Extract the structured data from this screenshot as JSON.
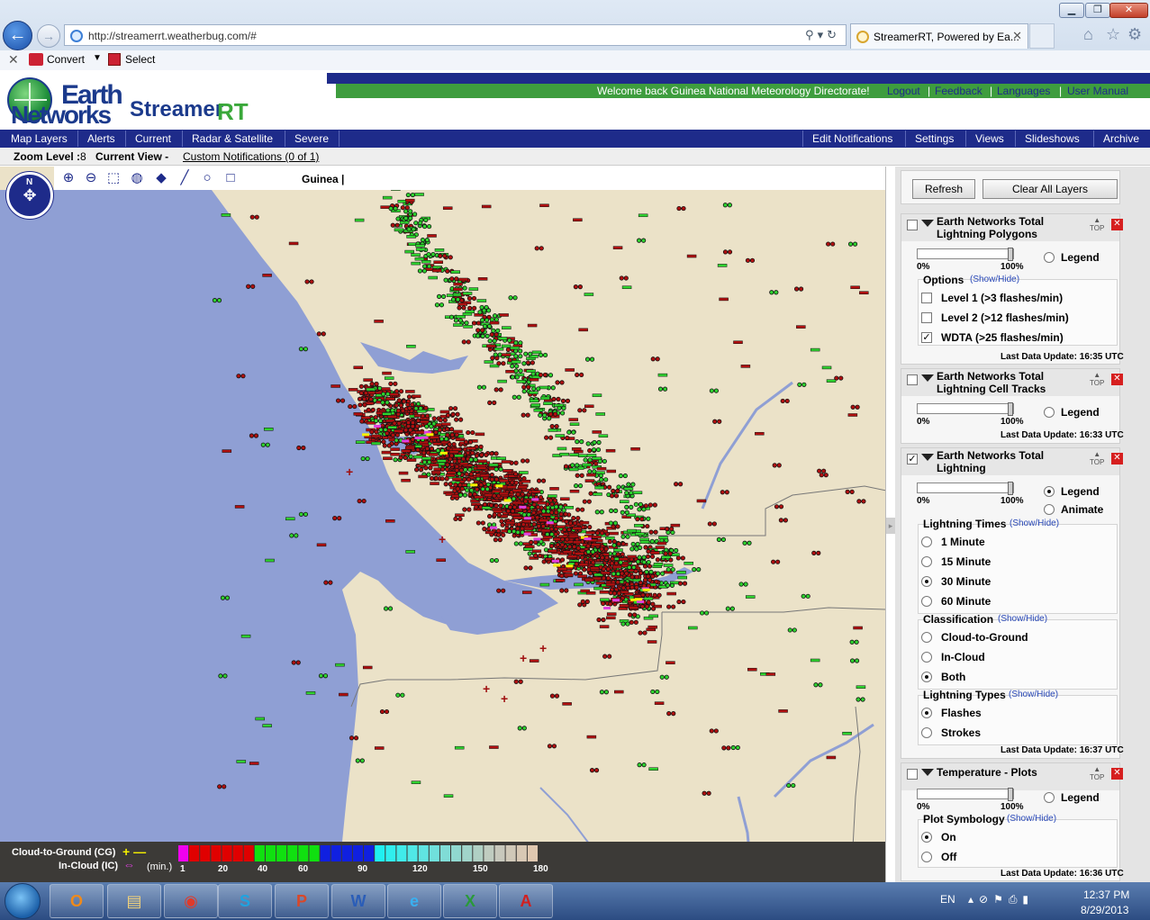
{
  "browser": {
    "url": "http://streamerrt.weatherbug.com/#",
    "tab_title": "StreamerRT, Powered by Ea...",
    "cmd_convert": "Convert",
    "cmd_select": "Select"
  },
  "header": {
    "logo_earth": "Earth",
    "logo_networks": "Networks",
    "logo_streamer": "Streamer",
    "logo_rt": "RT",
    "welcome": "Welcome back  Guinea National Meteorology Directorate!",
    "links": [
      "Logout",
      "Feedback",
      "Languages",
      "User Manual"
    ]
  },
  "menu": {
    "left": [
      "Map Layers",
      "Alerts",
      "Current",
      "Radar & Satellite",
      "Severe"
    ],
    "right": [
      "Edit Notifications",
      "Settings",
      "Views",
      "Slideshows",
      "Archive"
    ]
  },
  "status": {
    "zoom_label": "Zoom Level :",
    "zoom_value": "8",
    "current_view_label": "Current View -",
    "custom_notifications": "Custom Notifications (0 of 1)"
  },
  "map": {
    "region": "Guinea",
    "compass_n": "N",
    "tools": [
      "zoom-in-icon",
      "zoom-out-icon",
      "zoom-box-icon",
      "globe-icon",
      "eraser-icon",
      "line-icon",
      "circle-icon",
      "square-icon"
    ]
  },
  "legend": {
    "cg_label": "Cloud-to-Ground (CG)",
    "ic_label": "In-Cloud (IC)",
    "min_label": "(min.)",
    "scale_labels": [
      "1",
      "20",
      "40",
      "60",
      "90",
      "120",
      "150",
      "180"
    ],
    "colors": {
      "cg": "#f5f000",
      "ic": "#e040e0",
      "recent": "#f000f0",
      "red": "#e00000",
      "green": "#10e010",
      "blue": "#1020e0",
      "cyan": "#20f0f0"
    }
  },
  "panel": {
    "refresh": "Refresh",
    "clear_all": "Clear All Layers",
    "top": "TOP",
    "legend": "Legend",
    "animate": "Animate",
    "pct_min": "0%",
    "pct_max": "100%",
    "layer1": {
      "title": "Earth Networks Total Lightning Polygons",
      "checked": false,
      "options_title": "Options",
      "show_hide": "(Show/Hide)",
      "options": [
        {
          "label": "Level 1 (>3 flashes/min)",
          "checked": false
        },
        {
          "label": "Level 2 (>12 flashes/min)",
          "checked": false
        },
        {
          "label": "WDTA (>25 flashes/min)",
          "checked": true
        }
      ],
      "last_update": "Last Data Update:  16:35 UTC"
    },
    "layer2": {
      "title": "Earth Networks Total Lightning Cell Tracks",
      "checked": false,
      "last_update": "Last Data Update:  16:33 UTC"
    },
    "layer3": {
      "title": "Earth Networks Total Lightning",
      "checked": true,
      "times_title": "Lightning Times",
      "times": [
        "1 Minute",
        "15 Minute",
        "30 Minute",
        "60 Minute"
      ],
      "times_selected": 2,
      "class_title": "Classification",
      "classes": [
        "Cloud-to-Ground",
        "In-Cloud",
        "Both"
      ],
      "class_selected": 2,
      "types_title": "Lightning Types",
      "types": [
        "Flashes",
        "Strokes"
      ],
      "types_selected": 0,
      "last_update": "Last Data Update:  16:37 UTC"
    },
    "layer4": {
      "title": "Temperature - Plots",
      "checked": false,
      "symb_title": "Plot Symbology",
      "symb": [
        "On",
        "Off"
      ],
      "symb_selected": 0,
      "last_update": "Last Data Update:  16:36 UTC"
    }
  },
  "taskbar": {
    "apps": [
      "O",
      "▤",
      "◉",
      "S",
      "P",
      "W",
      "e",
      "X",
      "A"
    ],
    "lang": "EN",
    "time": "12:37 PM",
    "date": "8/29/2013"
  }
}
